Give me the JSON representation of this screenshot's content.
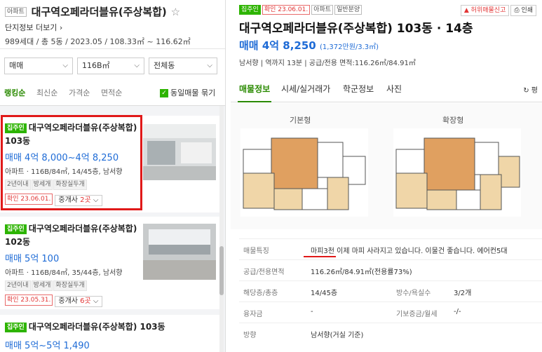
{
  "left": {
    "tag": "아파트",
    "title": "대구역오페라더블유(주상복합)",
    "more_link": "단지정보 더보기",
    "meta": "989세대 / 총 5동 / 2023.05 / 108.33㎡ ~ 116.62㎡",
    "filters": [
      "매매",
      "116B㎡",
      "전체동"
    ],
    "sorts": [
      "랭킹순",
      "최신순",
      "가격순",
      "면적순"
    ],
    "same_listing_label": "동일매물 묶기",
    "cards": [
      {
        "tag": "집주인",
        "name": "대구역오페라더블유(주상복합)",
        "dong": "103동",
        "price": "매매 4억 8,000~4억 8,250",
        "spec": "아파트 · 116B/84㎡, 14/45층, 남서향",
        "chips": [
          "2년이내",
          "방세개",
          "화장실두개"
        ],
        "confirm": "확인 23.06.01.",
        "broker_prefix": "중개사 ",
        "broker_count": "2곳"
      },
      {
        "tag": "집주인",
        "name": "대구역오페라더블유(주상복합)",
        "dong": "102동",
        "price": "매매 5억 100",
        "spec": "아파트 · 116B/84㎡, 35/44층, 남서향",
        "chips": [
          "2년이내",
          "방세개",
          "화장실두개"
        ],
        "confirm": "확인 23.05.31.",
        "broker_prefix": "중개사 ",
        "broker_count": "6곳"
      },
      {
        "tag": "집주인",
        "name": "대구역오페라더블유(주상복합) 103동",
        "price": "매매 5억~5억 1,490"
      }
    ]
  },
  "right": {
    "tags": [
      "집주인",
      "확인 23.06.01.",
      "아파트",
      "일반분양"
    ],
    "buttons": {
      "report": "허위매물신고",
      "print": "인쇄"
    },
    "title": "대구역오페라더블유(주상복합) 103동 · 14층",
    "price": "매매 4억 8,250",
    "price_unit": "(1,372만원/3.3㎡)",
    "meta": "남서향 | 역까지 13분 | 공급/전용 면적:116.26㎡/84.91㎡",
    "tabs": [
      "매물정보",
      "시세/실거래가",
      "학군정보",
      "사진"
    ],
    "refresh": "평",
    "plan_labels": [
      "기본형",
      "확장형"
    ],
    "table": {
      "feature_k": "매물특징",
      "feature_v": "마피3천 이제 마피 사라지고 있습니다. 이물건 좋습니다. 에어컨5대",
      "area_k": "공급/전용면적",
      "area_v": "116.26㎡/84.91㎡(전용률73%)",
      "floor_k": "해당층/총층",
      "floor_v": "14/45층",
      "rooms_k": "방수/욕실수",
      "rooms_v": "3/2개",
      "loan_k": "융자금",
      "loan_v": "-",
      "deposit_k": "기보증금/월세",
      "deposit_v": "-/-",
      "dir_k": "방향",
      "dir_v": "남서향(거실 기준)"
    }
  },
  "colors": {
    "accent_green": "#2db400",
    "price_blue": "#1e6bd6",
    "highlight_red": "#e01919"
  }
}
